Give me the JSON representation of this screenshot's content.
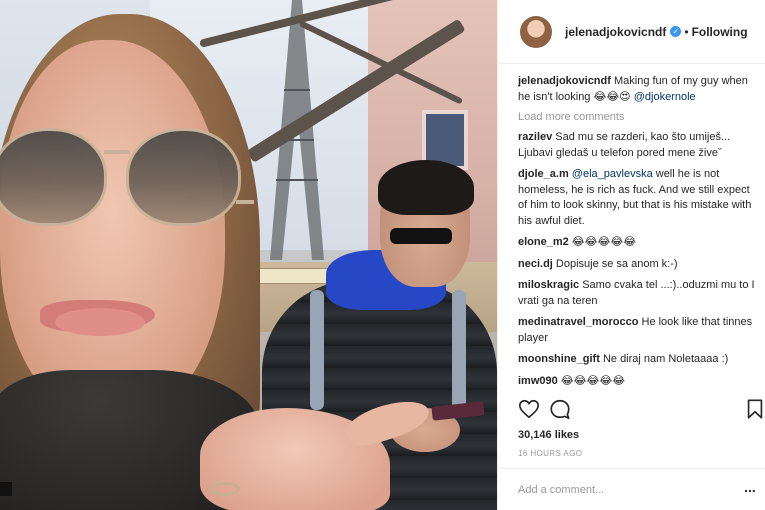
{
  "post": {
    "username": "jelenadjokovicndf",
    "follow_status": "Following",
    "dot": "•",
    "verified_glyph": "✓",
    "caption": {
      "username": "jelenadjokovicndf",
      "text": " Making fun of my guy when he isn't looking 😂😂😍 ",
      "mention": "@djokernole"
    },
    "load_more": "Load more comments",
    "comments": [
      {
        "username": "razilev",
        "text": " Sad mu se razderi, kao što umiješ... Ljubavi gledaš u telefon pored mene živeˇ"
      },
      {
        "username": "djole_a.m",
        "mention": " @ela_pavlevska",
        "text": " well he is not homeless, he is rich as fuck. And we still expect of him to look skinny, but that is his mistake with his awful diet."
      },
      {
        "username": "elone_m2",
        "text": " 😂😂😂😂😂"
      },
      {
        "username": "neci.dj",
        "text": " Dopisuje se sa anom k:-)"
      },
      {
        "username": "miloskragic",
        "text": " Samo cvaka tel ...:)..oduzmi mu to I vrati ga na teren"
      },
      {
        "username": "medinatravel_morocco",
        "text": " He look like that tinnes player"
      },
      {
        "username": "moonshine_gift",
        "text": " Ne diraj nam Noletaaaa :)"
      },
      {
        "username": "imw090",
        "text": " 😂😂😂😂😂"
      }
    ],
    "likes": "30,146 likes",
    "time": "16 HOURS AGO",
    "add_comment_placeholder": "Add a comment...",
    "more_label": "..."
  },
  "icons": [
    "heart-icon",
    "comment-icon",
    "bookmark-icon",
    "verified-badge-icon"
  ],
  "colors": {
    "verified": "#3897f0",
    "mention": "#003569",
    "muted": "#999999",
    "text": "#262626"
  }
}
